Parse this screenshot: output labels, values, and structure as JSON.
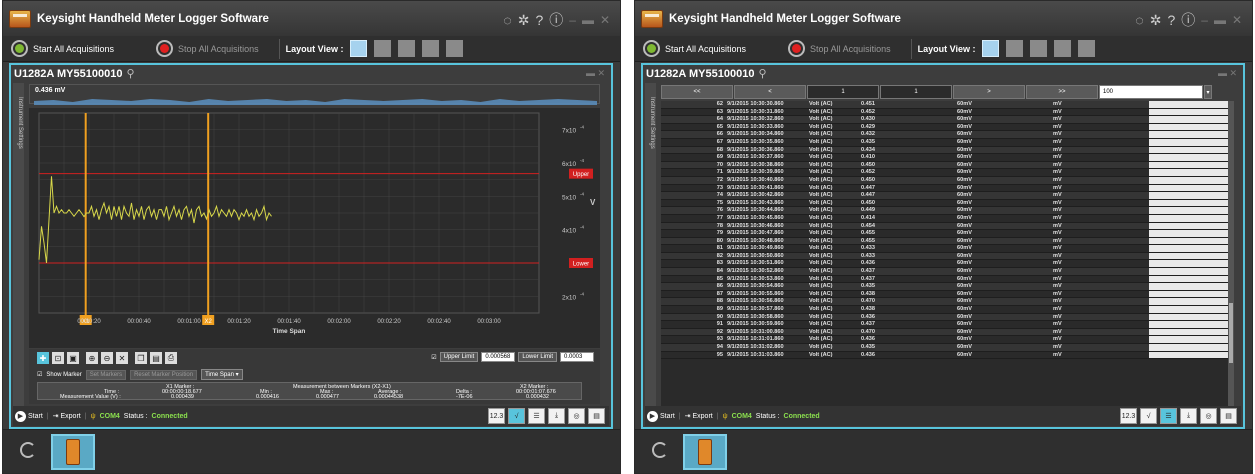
{
  "app": {
    "title": "Keysight Handheld Meter Logger Software",
    "toolbar": {
      "start_all": "Start All Acquisitions",
      "stop_all": "Stop All Acquisitions",
      "layout_view": "Layout View :"
    },
    "device_title": "U1282A  MY55100010",
    "side_tab": "Instrument Settings",
    "bottom": {
      "start": "Start",
      "export": "Export",
      "com": "COM4",
      "status_label": "Status :",
      "status_value": "Connected",
      "digits_badge": "12.3"
    }
  },
  "colors": {
    "accent": "#58c4dc",
    "trace": "#d8d84a",
    "marker": "#f0a020",
    "limit": "#d22020",
    "status_ok": "#8be04e"
  },
  "chart_window": {
    "overview_value": "0.436 mV",
    "upper_tag": "Upper",
    "lower_tag": "Lower",
    "y_unit": "V",
    "marker1": "X1",
    "marker2": "X2",
    "controls": {
      "upper_limit_label": "Upper Limit",
      "upper_limit_value": "0.000568",
      "lower_limit_label": "Lower Limit",
      "lower_limit_value": "0.0003",
      "show_marker": "Show Marker",
      "set_markers": "Set Markers",
      "reset_marker": "Reset Marker Position",
      "time_span": "Time Span"
    },
    "marker_table": {
      "x1_header": "X1 Marker :",
      "between_header": "Measurement between Markers (X2-X1)",
      "x2_header": "X2 Marker :",
      "time_label": "Time :",
      "mv_label": "Measurement Value  (V) :",
      "x1_time": "00:00:00:18.677",
      "x1_value": "0.000439",
      "min_label": "Min :",
      "min_value": "0.000416",
      "max_label": "Max :",
      "max_value": "0.000477",
      "avg_label": "Average :",
      "avg_value": "0.00044538",
      "delta_label": "Delta :",
      "delta_value": "-7E-06",
      "x2_time": "00:00:01:07.676",
      "x2_value": "0.000432"
    }
  },
  "chart_data": {
    "type": "line",
    "title": "",
    "xlabel": "Time Span",
    "ylabel": "V",
    "x_ticks": [
      "00:00:20",
      "00:00:40",
      "00:01:00",
      "00:01:20",
      "00:01:40",
      "00:02:00",
      "00:02:20",
      "00:02:40",
      "00:03:00"
    ],
    "y_ticks": [
      {
        "base": "7x10",
        "exp": "-4",
        "value": 0.0007
      },
      {
        "base": "6x10",
        "exp": "-4",
        "value": 0.0006
      },
      {
        "base": "5x10",
        "exp": "-4",
        "value": 0.0005
      },
      {
        "base": "4x10",
        "exp": "-4",
        "value": 0.0004
      },
      {
        "base": "2x10",
        "exp": "-4",
        "value": 0.0002
      }
    ],
    "ylim": [
      0.00015,
      0.00075
    ],
    "xlim": [
      0,
      200
    ],
    "upper_limit": 0.000568,
    "lower_limit": 0.0003,
    "markers_s": [
      18.677,
      67.676
    ],
    "series": [
      {
        "x": [
          0,
          1,
          2,
          3,
          4,
          5,
          6,
          7,
          8,
          9,
          10,
          11,
          12,
          13,
          14,
          15,
          16,
          17,
          18,
          19,
          20,
          21,
          22,
          23,
          24,
          25,
          26,
          27,
          28,
          29,
          30,
          31,
          32,
          33,
          34,
          35,
          36,
          37,
          38,
          39,
          40,
          41,
          42,
          43,
          44,
          45,
          46,
          47,
          48,
          49,
          50,
          51,
          52,
          53,
          54,
          55,
          56,
          57,
          58,
          59,
          60,
          61,
          62,
          63,
          64,
          65,
          66,
          67,
          68,
          69,
          70,
          71,
          72,
          73,
          74,
          75,
          76,
          77,
          78,
          79,
          80,
          81,
          82,
          83,
          84,
          85,
          86,
          87,
          88,
          89,
          90,
          91,
          92,
          93
        ],
        "y": [
          0.00031,
          0.00041,
          0.00036,
          0.0003,
          0.00043,
          0.00056,
          0.00045,
          0.00047,
          0.00045,
          0.00046,
          0.00045,
          0.00045,
          0.00046,
          0.00045,
          0.00044,
          0.00045,
          0.00046,
          0.00045,
          0.000439,
          0.00045,
          0.00045,
          0.00047,
          0.00044,
          0.00046,
          0.00043,
          0.00046,
          0.00048,
          0.00045,
          0.00047,
          0.00043,
          0.00047,
          0.00044,
          0.00047,
          0.00043,
          0.00047,
          0.00045,
          0.00044,
          0.00048,
          0.00043,
          0.00046,
          0.00044,
          0.00047,
          0.00043,
          0.00046,
          0.00047,
          0.00044,
          0.00046,
          0.00043,
          0.00046,
          0.00046,
          0.00044,
          0.00047,
          0.00043,
          0.00045,
          0.00047,
          0.00044,
          0.00046,
          0.00043,
          0.00046,
          0.00047,
          0.00044,
          0.00046,
          0.00042,
          0.00046,
          0.00047,
          0.00044,
          0.00045,
          0.000432,
          0.00046,
          0.00044,
          0.00045,
          0.00047,
          0.00044,
          0.00046,
          0.00045,
          0.00044,
          0.00046,
          0.00044,
          0.00046,
          0.00045,
          0.00043,
          0.00045,
          0.00044,
          0.00046,
          0.00044,
          0.00045,
          0.00043,
          0.00046,
          0.00044,
          0.00045,
          0.00047,
          0.00043,
          0.00045,
          0.00044
        ]
      }
    ],
    "overview": [
      0.44,
      0.45,
      0.43,
      0.46,
      0.45,
      0.44,
      0.46,
      0.45,
      0.43,
      0.46,
      0.44,
      0.45,
      0.46,
      0.44,
      0.45,
      0.43,
      0.46,
      0.45,
      0.44,
      0.45,
      0.46,
      0.44,
      0.45,
      0.43,
      0.46,
      0.44,
      0.45,
      0.46,
      0.45,
      0.44
    ]
  },
  "table_window": {
    "nav": {
      "first": "<<",
      "prev": "<",
      "page_input": "1",
      "page_label": "1",
      "next": ">",
      "last": ">>",
      "rows_per_page": "100"
    },
    "rows": [
      [
        "62",
        "9/1/2015 10:30:30.860",
        "Volt (AC)",
        "0.451",
        "60mV",
        "mV"
      ],
      [
        "63",
        "9/1/2015 10:30:31.860",
        "Volt (AC)",
        "0.452",
        "60mV",
        "mV"
      ],
      [
        "64",
        "9/1/2015 10:30:32.860",
        "Volt (AC)",
        "0.430",
        "60mV",
        "mV"
      ],
      [
        "65",
        "9/1/2015 10:30:33.860",
        "Volt (AC)",
        "0.429",
        "60mV",
        "mV"
      ],
      [
        "66",
        "9/1/2015 10:30:34.860",
        "Volt (AC)",
        "0.432",
        "60mV",
        "mV"
      ],
      [
        "67",
        "9/1/2015 10:30:35.860",
        "Volt (AC)",
        "0.435",
        "60mV",
        "mV"
      ],
      [
        "68",
        "9/1/2015 10:30:36.860",
        "Volt (AC)",
        "0.434",
        "60mV",
        "mV"
      ],
      [
        "69",
        "9/1/2015 10:30:37.860",
        "Volt (AC)",
        "0.410",
        "60mV",
        "mV"
      ],
      [
        "70",
        "9/1/2015 10:30:38.860",
        "Volt (AC)",
        "0.450",
        "60mV",
        "mV"
      ],
      [
        "71",
        "9/1/2015 10:30:39.860",
        "Volt (AC)",
        "0.452",
        "60mV",
        "mV"
      ],
      [
        "72",
        "9/1/2015 10:30:40.860",
        "Volt (AC)",
        "0.450",
        "60mV",
        "mV"
      ],
      [
        "73",
        "9/1/2015 10:30:41.860",
        "Volt (AC)",
        "0.447",
        "60mV",
        "mV"
      ],
      [
        "74",
        "9/1/2015 10:30:42.860",
        "Volt (AC)",
        "0.447",
        "60mV",
        "mV"
      ],
      [
        "75",
        "9/1/2015 10:30:43.860",
        "Volt (AC)",
        "0.450",
        "60mV",
        "mV"
      ],
      [
        "76",
        "9/1/2015 10:30:44.860",
        "Volt (AC)",
        "0.449",
        "60mV",
        "mV"
      ],
      [
        "77",
        "9/1/2015 10:30:45.860",
        "Volt (AC)",
        "0.414",
        "60mV",
        "mV"
      ],
      [
        "78",
        "9/1/2015 10:30:46.860",
        "Volt (AC)",
        "0.454",
        "60mV",
        "mV"
      ],
      [
        "79",
        "9/1/2015 10:30:47.860",
        "Volt (AC)",
        "0.455",
        "60mV",
        "mV"
      ],
      [
        "80",
        "9/1/2015 10:30:48.860",
        "Volt (AC)",
        "0.455",
        "60mV",
        "mV"
      ],
      [
        "81",
        "9/1/2015 10:30:49.860",
        "Volt (AC)",
        "0.433",
        "60mV",
        "mV"
      ],
      [
        "82",
        "9/1/2015 10:30:50.860",
        "Volt (AC)",
        "0.433",
        "60mV",
        "mV"
      ],
      [
        "83",
        "9/1/2015 10:30:51.860",
        "Volt (AC)",
        "0.436",
        "60mV",
        "mV"
      ],
      [
        "84",
        "9/1/2015 10:30:52.860",
        "Volt (AC)",
        "0.437",
        "60mV",
        "mV"
      ],
      [
        "85",
        "9/1/2015 10:30:53.860",
        "Volt (AC)",
        "0.437",
        "60mV",
        "mV"
      ],
      [
        "86",
        "9/1/2015 10:30:54.860",
        "Volt (AC)",
        "0.435",
        "60mV",
        "mV"
      ],
      [
        "87",
        "9/1/2015 10:30:55.860",
        "Volt (AC)",
        "0.438",
        "60mV",
        "mV"
      ],
      [
        "88",
        "9/1/2015 10:30:56.860",
        "Volt (AC)",
        "0.470",
        "60mV",
        "mV"
      ],
      [
        "89",
        "9/1/2015 10:30:57.860",
        "Volt (AC)",
        "0.438",
        "60mV",
        "mV"
      ],
      [
        "90",
        "9/1/2015 10:30:58.860",
        "Volt (AC)",
        "0.436",
        "60mV",
        "mV"
      ],
      [
        "91",
        "9/1/2015 10:30:59.860",
        "Volt (AC)",
        "0.437",
        "60mV",
        "mV"
      ],
      [
        "92",
        "9/1/2015 10:31:00.860",
        "Volt (AC)",
        "0.470",
        "60mV",
        "mV"
      ],
      [
        "93",
        "9/1/2015 10:31:01.860",
        "Volt (AC)",
        "0.436",
        "60mV",
        "mV"
      ],
      [
        "94",
        "9/1/2015 10:31:02.860",
        "Volt (AC)",
        "0.435",
        "60mV",
        "mV"
      ],
      [
        "95",
        "9/1/2015 10:31:03.860",
        "Volt (AC)",
        "0.436",
        "60mV",
        "mV"
      ]
    ]
  }
}
